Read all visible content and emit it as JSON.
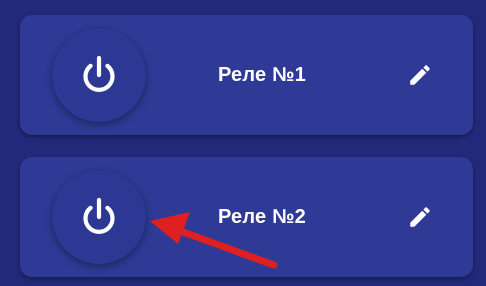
{
  "relays": [
    {
      "label": "Реле №1",
      "power_icon": "power-icon",
      "edit_icon": "pencil-icon"
    },
    {
      "label": "Реле №2",
      "power_icon": "power-icon",
      "edit_icon": "pencil-icon"
    }
  ],
  "annotation": {
    "icon": "red-arrow-icon",
    "color": "#e02020"
  },
  "colors": {
    "background": "#22297a",
    "card": "#2e3a96",
    "text": "#ffffff"
  }
}
